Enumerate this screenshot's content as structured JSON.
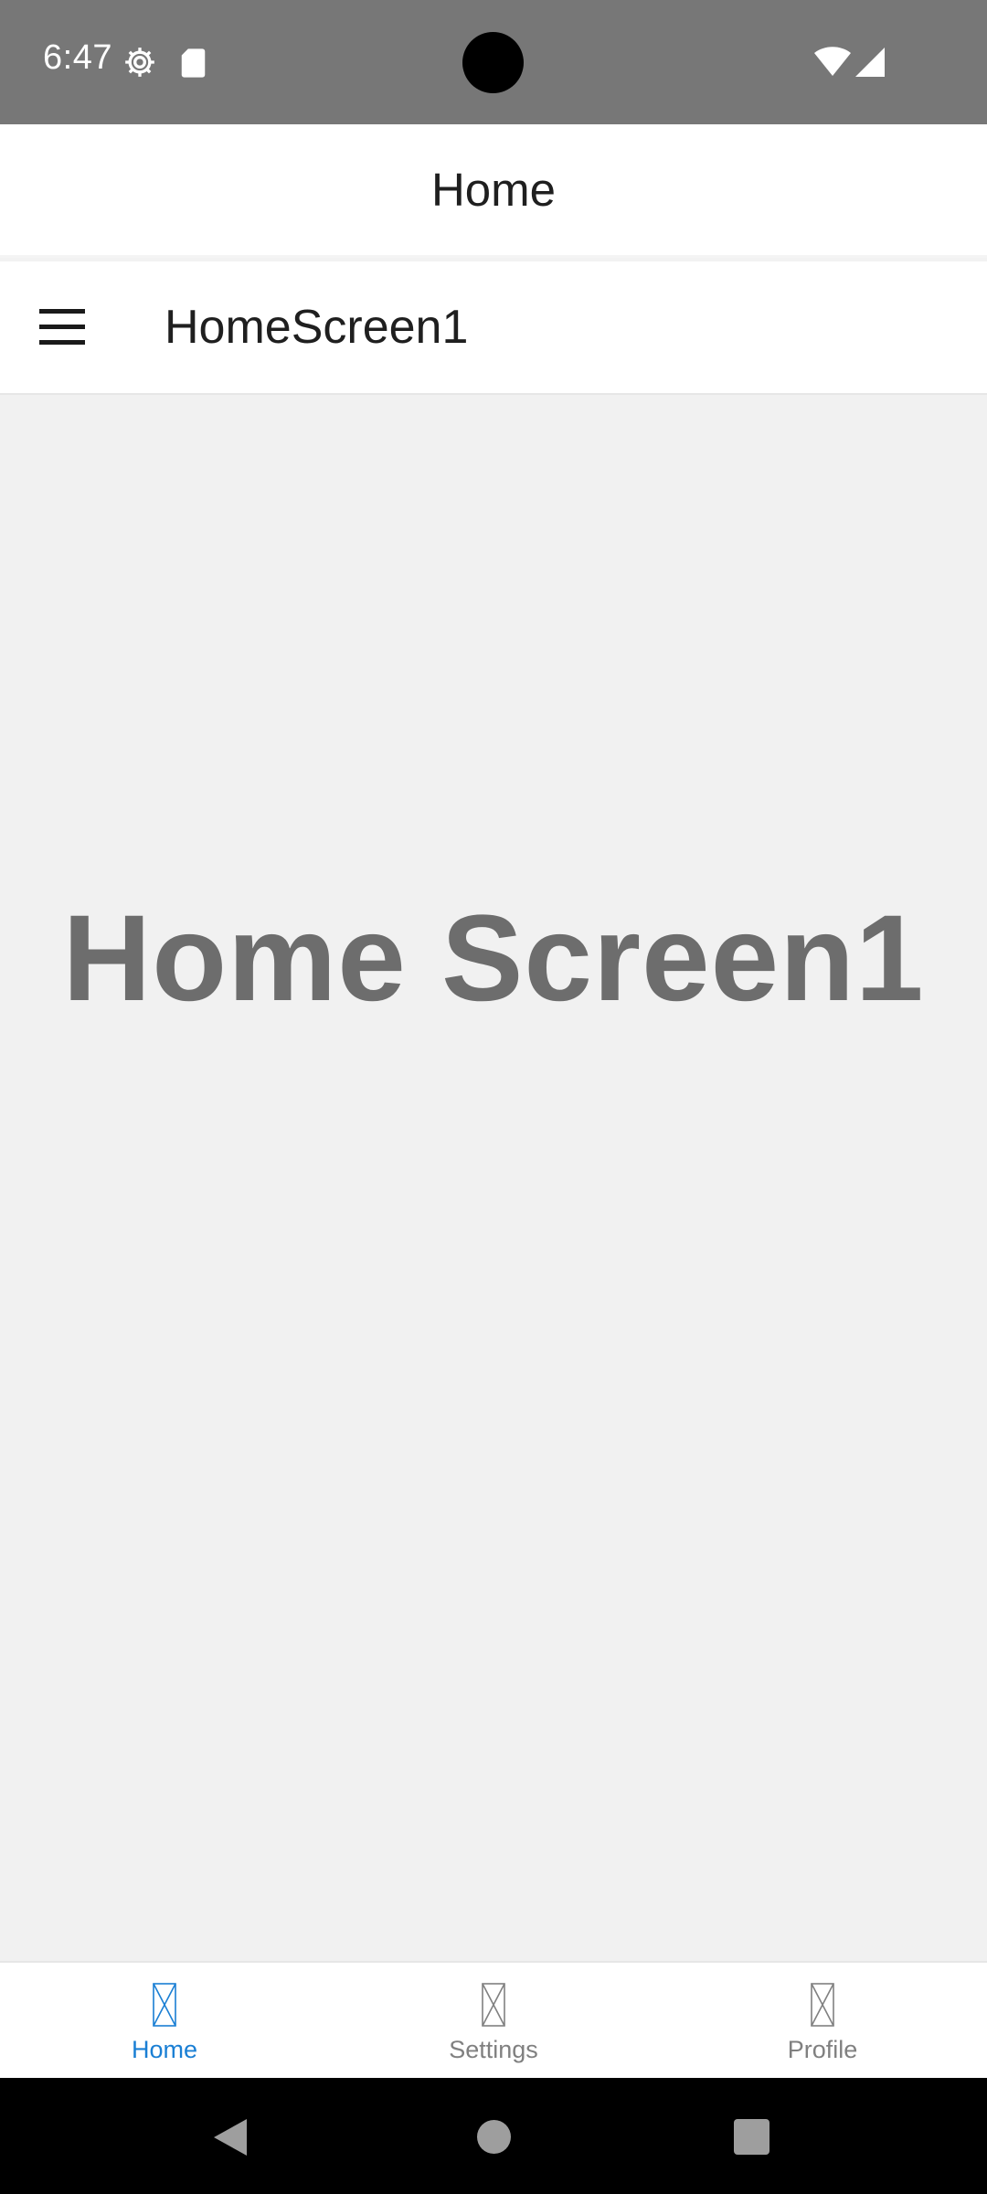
{
  "status_bar": {
    "time": "6:47",
    "icons": [
      "gear-icon",
      "sd-card-icon",
      "wifi-icon",
      "signal-icon"
    ]
  },
  "app_bar": {
    "title": "Home"
  },
  "toolbar": {
    "menu_icon": "hamburger-menu-icon",
    "title": "HomeScreen1"
  },
  "main": {
    "heading": "Home Screen1"
  },
  "bottom_nav": {
    "items": [
      {
        "label": "Home",
        "icon": "placeholder-icon",
        "selected": true
      },
      {
        "label": "Settings",
        "icon": "placeholder-icon",
        "selected": false
      },
      {
        "label": "Profile",
        "icon": "placeholder-icon",
        "selected": false
      }
    ]
  },
  "system_nav": {
    "buttons": [
      "back-icon",
      "home-icon",
      "recents-icon"
    ]
  },
  "colors": {
    "status_bar": "#777777",
    "accent": "#1a7fd4",
    "inactive": "#808080",
    "heading": "#6d6d6d",
    "background": "#f1f1f1"
  }
}
